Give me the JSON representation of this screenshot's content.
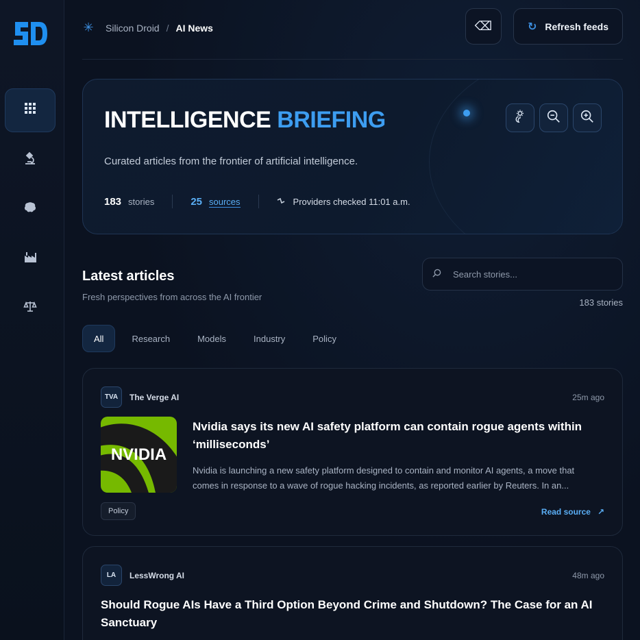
{
  "breadcrumb": {
    "root": "Silicon Droid",
    "separator": "/",
    "current": "AI News"
  },
  "actions": {
    "clear_icon": "⌫",
    "refresh_label": "Refresh feeds"
  },
  "hero": {
    "title_part1": "INTELLIGENCE",
    "title_part2": "BRIEFING",
    "subtitle": "Curated articles from the frontier of artificial intelligence.",
    "stories_count": "183",
    "stories_label": "stories",
    "sources_count": "25",
    "sources_label": "sources",
    "checked_label": "Providers checked 11:01 a.m."
  },
  "section": {
    "title": "Latest articles",
    "subtitle": "Fresh perspectives from across the AI frontier",
    "count_label": "183 stories"
  },
  "search": {
    "placeholder": "Search stories...",
    "value": ""
  },
  "tabs": [
    {
      "label": "All",
      "active": true
    },
    {
      "label": "Research",
      "active": false
    },
    {
      "label": "Models",
      "active": false
    },
    {
      "label": "Industry",
      "active": false
    },
    {
      "label": "Policy",
      "active": false
    }
  ],
  "articles": [
    {
      "source_abbr": "TVA",
      "source_name": "The Verge AI",
      "time": "25m ago",
      "thumb_text": "NVIDIA",
      "title": "Nvidia says its new AI safety platform can contain rogue agents within ‘milliseconds’",
      "description": "Nvidia is launching a new safety platform designed to contain and monitor AI agents, a move that comes in response to a wave of rogue hacking incidents, as reported earlier by Reuters. In an...",
      "tag": "Policy",
      "read_label": "Read source",
      "read_icon": "↗"
    },
    {
      "source_abbr": "LA",
      "source_name": "LessWrong AI",
      "time": "48m ago",
      "title": "Should Rogue AIs Have a Third Option Beyond Crime and Shutdown? The Case for an AI Sanctuary"
    }
  ],
  "colors": {
    "accent": "#3d9df0",
    "background": "#0b1220",
    "nvidia_green": "#76b900"
  },
  "icons": {
    "logo": "silicon-droid-logo",
    "nav": [
      "grid-icon",
      "microscope-icon",
      "brain-icon",
      "factory-icon",
      "scales-icon"
    ],
    "theme": "sun-moon-icon",
    "zoom_out": "zoom-out-icon",
    "zoom_in": "zoom-in-icon"
  }
}
